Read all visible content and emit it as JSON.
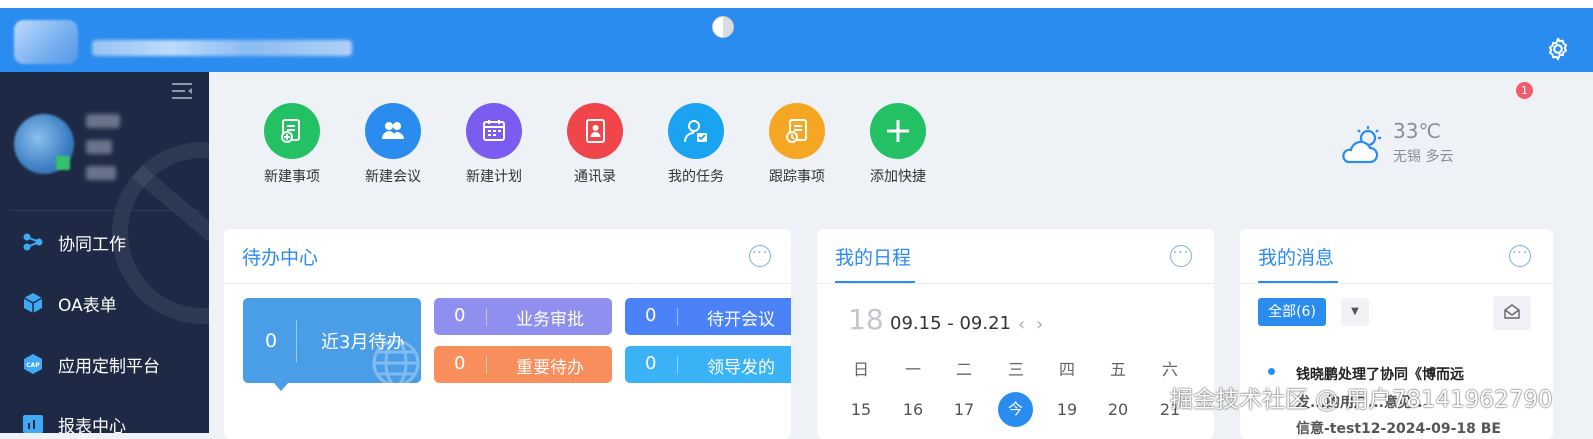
{
  "quick_actions": [
    {
      "label": "新建事项",
      "icon": "new-item-icon",
      "color": "#23c163"
    },
    {
      "label": "新建会议",
      "icon": "meeting-icon",
      "color": "#2b8cf0"
    },
    {
      "label": "新建计划",
      "icon": "plan-icon",
      "color": "#7b5cf0"
    },
    {
      "label": "通讯录",
      "icon": "contacts-icon",
      "color": "#f0454a"
    },
    {
      "label": "我的任务",
      "icon": "task-icon",
      "color": "#1aa3f0"
    },
    {
      "label": "跟踪事项",
      "icon": "track-icon",
      "color": "#f5a623"
    },
    {
      "label": "添加快捷",
      "icon": "plus-icon",
      "color": "#23c163"
    }
  ],
  "sidebar": {
    "items": [
      {
        "label": "协同工作",
        "icon": "collaboration-icon"
      },
      {
        "label": "OA表单",
        "icon": "form-cube-icon"
      },
      {
        "label": "应用定制平台",
        "icon": "cap-icon"
      },
      {
        "label": "报表中心",
        "icon": "report-icon"
      }
    ]
  },
  "notifications": {
    "count": "1"
  },
  "weather": {
    "temp": "33℃",
    "city": "无锡 多云",
    "icon": "cloud-sun-icon"
  },
  "todo": {
    "title": "待办中心",
    "main": {
      "count": "0",
      "label": "近3月待办"
    },
    "tiles": [
      {
        "count": "0",
        "label": "业务审批",
        "color": "#8f8ff0"
      },
      {
        "count": "0",
        "label": "待开会议",
        "color": "#4c82f7"
      },
      {
        "count": "0",
        "label": "重要待办",
        "color": "#f78e5c"
      },
      {
        "count": "0",
        "label": "领导发的",
        "color": "#3bb2f5"
      }
    ]
  },
  "schedule": {
    "title": "我的日程",
    "day": "18",
    "range": "09.15 - 09.21",
    "prev": "‹",
    "next": "›",
    "weekdays": [
      "日",
      "一",
      "二",
      "三",
      "四",
      "五",
      "六"
    ],
    "dates": [
      "15",
      "16",
      "17",
      "今",
      "19",
      "20",
      "21"
    ]
  },
  "messages": {
    "title": "我的消息",
    "filter_all": "全部(6)",
    "dropdown": "▼",
    "line1": "钱晓鹏处理了协同《博而远",
    "line2": "发...的用户...意见...",
    "line3": "信意-test12-2024-09-18 BE"
  },
  "watermark": "掘金技术社区 @ 用户7814196279​0"
}
